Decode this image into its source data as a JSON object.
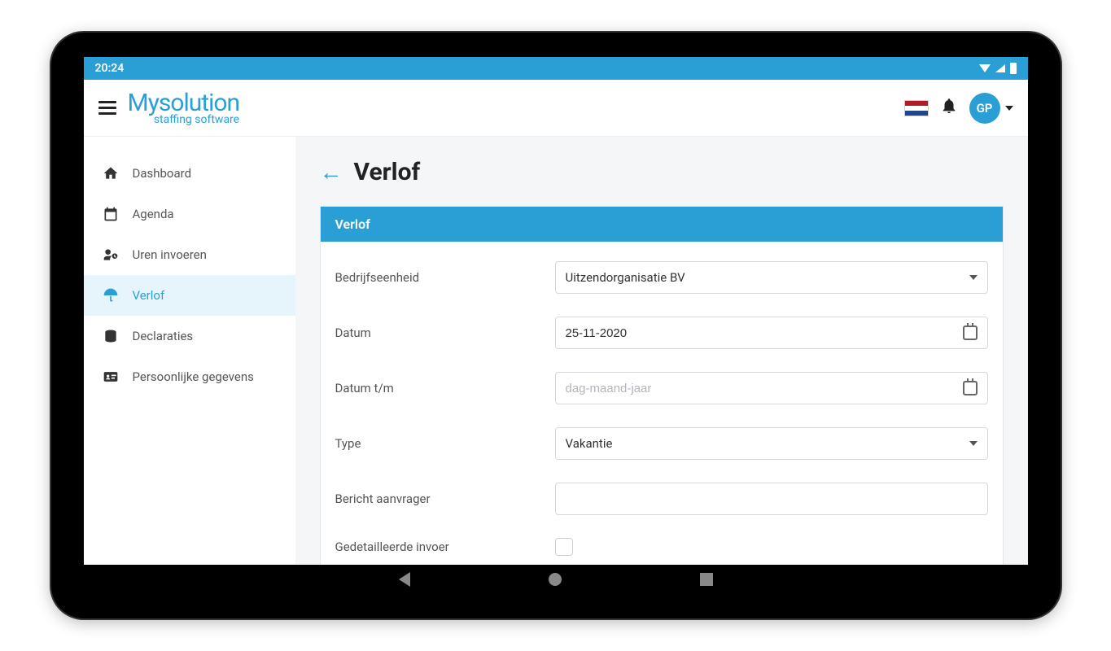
{
  "status": {
    "time": "20:24"
  },
  "header": {
    "logo_main": "Mysolution",
    "logo_sub": "staffing software",
    "avatar_initials": "GP"
  },
  "sidebar": {
    "items": [
      {
        "label": "Dashboard"
      },
      {
        "label": "Agenda"
      },
      {
        "label": "Uren invoeren"
      },
      {
        "label": "Verlof"
      },
      {
        "label": "Declaraties"
      },
      {
        "label": "Persoonlijke gegevens"
      }
    ]
  },
  "page": {
    "title": "Verlof"
  },
  "form": {
    "card_title": "Verlof",
    "fields": {
      "bedrijfseenheid": {
        "label": "Bedrijfseenheid",
        "value": "Uitzendorganisatie BV"
      },
      "datum": {
        "label": "Datum",
        "value": "25-11-2020"
      },
      "datum_tm": {
        "label": "Datum t/m",
        "placeholder": "dag-maand-jaar"
      },
      "type": {
        "label": "Type",
        "value": "Vakantie"
      },
      "bericht": {
        "label": "Bericht aanvrager",
        "value": ""
      },
      "gedetailleerd": {
        "label": "Gedetailleerde invoer"
      }
    }
  }
}
